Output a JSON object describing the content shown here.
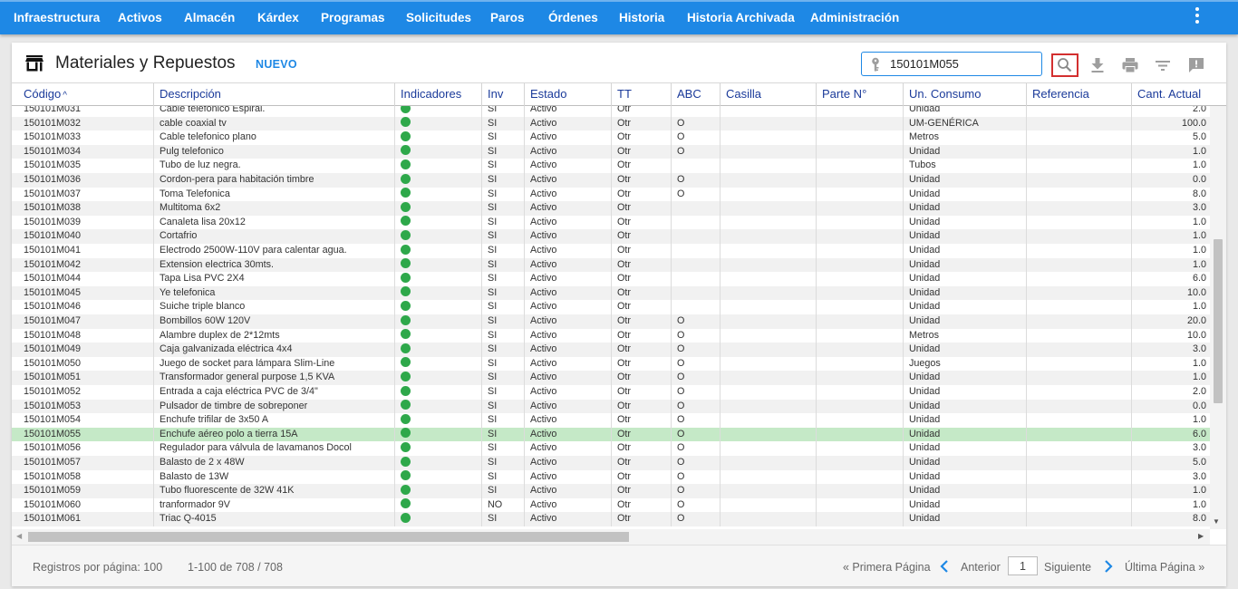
{
  "nav": {
    "items": [
      "Infraestructura",
      "Activos",
      "Almacén",
      "Kárdex",
      "Programas",
      "Solicitudes",
      "Paros",
      "Órdenes",
      "Historia",
      "Historia Archivada",
      "Administración"
    ]
  },
  "page": {
    "title": "Materiales y Repuestos",
    "new_label": "NUEVO"
  },
  "search": {
    "value": "150101M055"
  },
  "colors": {
    "nav_bg": "#1e88e5",
    "header_text": "#1a3a9a",
    "indicator": "#2ea84a",
    "selected_row": "#c5e9c7",
    "search_button_border": "#d32f2f"
  },
  "icons": [
    "store-icon",
    "key-icon",
    "search-icon",
    "download-icon",
    "print-icon",
    "filter-icon",
    "feedback-icon",
    "more-vert-icon",
    "chevron-left-icon",
    "chevron-right-icon"
  ],
  "table": {
    "columns": [
      "Código",
      "Descripción",
      "Indicadores",
      "Inv",
      "Estado",
      "TT",
      "ABC",
      "Casilla",
      "Parte N°",
      "Un. Consumo",
      "Referencia",
      "Cant. Actual"
    ],
    "sort_indicator": "^",
    "selected_code": "150101M055",
    "rows": [
      [
        "150101M031",
        "Cable telefonico Espiral.",
        "SI",
        "Activo",
        "Otr",
        "",
        "",
        "",
        "Unidad",
        "",
        "2.0"
      ],
      [
        "150101M032",
        "cable coaxial tv",
        "SI",
        "Activo",
        "Otr",
        "O",
        "",
        "",
        "UM-GENÉRICA",
        "",
        "100.0"
      ],
      [
        "150101M033",
        "Cable telefonico plano",
        "SI",
        "Activo",
        "Otr",
        "O",
        "",
        "",
        "Metros",
        "",
        "5.0"
      ],
      [
        "150101M034",
        "Pulg telefonico",
        "SI",
        "Activo",
        "Otr",
        "O",
        "",
        "",
        "Unidad",
        "",
        "1.0"
      ],
      [
        "150101M035",
        "Tubo de luz negra.",
        "SI",
        "Activo",
        "Otr",
        "",
        "",
        "",
        "Tubos",
        "",
        "1.0"
      ],
      [
        "150101M036",
        "Cordon-pera para habitación timbre",
        "SI",
        "Activo",
        "Otr",
        "O",
        "",
        "",
        "Unidad",
        "",
        "0.0"
      ],
      [
        "150101M037",
        "Toma Telefonica",
        "SI",
        "Activo",
        "Otr",
        "O",
        "",
        "",
        "Unidad",
        "",
        "8.0"
      ],
      [
        "150101M038",
        "Multitoma 6x2",
        "SI",
        "Activo",
        "Otr",
        "",
        "",
        "",
        "Unidad",
        "",
        "3.0"
      ],
      [
        "150101M039",
        "Canaleta lisa 20x12",
        "SI",
        "Activo",
        "Otr",
        "",
        "",
        "",
        "Unidad",
        "",
        "1.0"
      ],
      [
        "150101M040",
        "Cortafrio",
        "SI",
        "Activo",
        "Otr",
        "",
        "",
        "",
        "Unidad",
        "",
        "1.0"
      ],
      [
        "150101M041",
        "Electrodo 2500W-110V para calentar agua.",
        "SI",
        "Activo",
        "Otr",
        "",
        "",
        "",
        "Unidad",
        "",
        "1.0"
      ],
      [
        "150101M042",
        "Extension electrica 30mts.",
        "SI",
        "Activo",
        "Otr",
        "",
        "",
        "",
        "Unidad",
        "",
        "1.0"
      ],
      [
        "150101M044",
        "Tapa Lisa PVC 2X4",
        "SI",
        "Activo",
        "Otr",
        "",
        "",
        "",
        "Unidad",
        "",
        "6.0"
      ],
      [
        "150101M045",
        "Ye telefonica",
        "SI",
        "Activo",
        "Otr",
        "",
        "",
        "",
        "Unidad",
        "",
        "10.0"
      ],
      [
        "150101M046",
        "Suiche triple blanco",
        "SI",
        "Activo",
        "Otr",
        "",
        "",
        "",
        "Unidad",
        "",
        "1.0"
      ],
      [
        "150101M047",
        "Bombillos 60W 120V",
        "SI",
        "Activo",
        "Otr",
        "O",
        "",
        "",
        "Unidad",
        "",
        "20.0"
      ],
      [
        "150101M048",
        "Alambre duplex de 2*12mts",
        "SI",
        "Activo",
        "Otr",
        "O",
        "",
        "",
        "Metros",
        "",
        "10.0"
      ],
      [
        "150101M049",
        "Caja galvanizada eléctrica 4x4",
        "SI",
        "Activo",
        "Otr",
        "O",
        "",
        "",
        "Unidad",
        "",
        "3.0"
      ],
      [
        "150101M050",
        "Juego de socket para lámpara Slim-Line",
        "SI",
        "Activo",
        "Otr",
        "O",
        "",
        "",
        "Juegos",
        "",
        "1.0"
      ],
      [
        "150101M051",
        "Transformador general purpose 1,5 KVA",
        "SI",
        "Activo",
        "Otr",
        "O",
        "",
        "",
        "Unidad",
        "",
        "1.0"
      ],
      [
        "150101M052",
        "Entrada a caja eléctrica PVC de 3/4\"",
        "SI",
        "Activo",
        "Otr",
        "O",
        "",
        "",
        "Unidad",
        "",
        "2.0"
      ],
      [
        "150101M053",
        "Pulsador de timbre de sobreponer",
        "SI",
        "Activo",
        "Otr",
        "O",
        "",
        "",
        "Unidad",
        "",
        "0.0"
      ],
      [
        "150101M054",
        "Enchufe trifilar de 3x50 A",
        "SI",
        "Activo",
        "Otr",
        "O",
        "",
        "",
        "Unidad",
        "",
        "1.0"
      ],
      [
        "150101M055",
        "Enchufe aéreo polo a tierra 15A",
        "SI",
        "Activo",
        "Otr",
        "O",
        "",
        "",
        "Unidad",
        "",
        "6.0"
      ],
      [
        "150101M056",
        "Regulador para válvula de lavamanos Docol",
        "SI",
        "Activo",
        "Otr",
        "O",
        "",
        "",
        "Unidad",
        "",
        "3.0"
      ],
      [
        "150101M057",
        "Balasto de 2 x 48W",
        "SI",
        "Activo",
        "Otr",
        "O",
        "",
        "",
        "Unidad",
        "",
        "5.0"
      ],
      [
        "150101M058",
        "Balasto de 13W",
        "SI",
        "Activo",
        "Otr",
        "O",
        "",
        "",
        "Unidad",
        "",
        "3.0"
      ],
      [
        "150101M059",
        "Tubo fluorescente de 32W 41K",
        "SI",
        "Activo",
        "Otr",
        "O",
        "",
        "",
        "Unidad",
        "",
        "1.0"
      ],
      [
        "150101M060",
        "tranformador 9V",
        "NO",
        "Activo",
        "Otr",
        "O",
        "",
        "",
        "Unidad",
        "",
        "1.0"
      ],
      [
        "150101M061",
        "Triac Q-4015",
        "SI",
        "Activo",
        "Otr",
        "O",
        "",
        "",
        "Unidad",
        "",
        "8.0"
      ]
    ]
  },
  "footer": {
    "records_per_page": "Registros por página: 100",
    "range": "1-100 de 708 / 708",
    "first_page": "« Primera Página",
    "previous": "Anterior",
    "page_number": "1",
    "next": "Siguiente",
    "last_page": "Última Página »"
  }
}
